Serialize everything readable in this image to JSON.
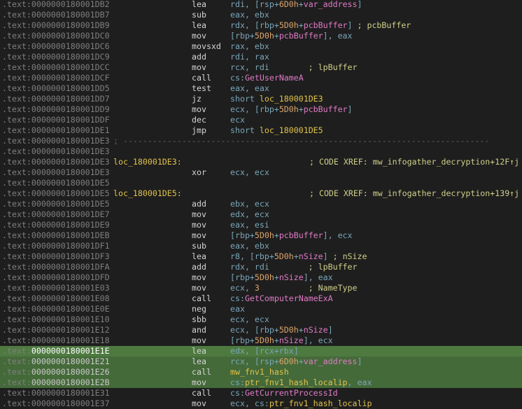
{
  "segment": ".text",
  "lines": [
    {
      "addr": "0000000180001DB2",
      "mnem": "lea",
      "ops": [
        {
          "t": "rdi, [rsp+",
          "c": "reg"
        },
        {
          "t": "6D0h",
          "c": "num"
        },
        {
          "t": "+",
          "c": "reg"
        },
        {
          "t": "var_address",
          "c": "sym"
        },
        {
          "t": "]",
          "c": "reg"
        }
      ]
    },
    {
      "addr": "0000000180001DB7",
      "mnem": "sub",
      "ops": [
        {
          "t": "eax, ebx",
          "c": "reg"
        }
      ]
    },
    {
      "addr": "0000000180001DB9",
      "mnem": "lea",
      "ops": [
        {
          "t": "rdx, [rbp+",
          "c": "reg"
        },
        {
          "t": "5D0h",
          "c": "num"
        },
        {
          "t": "+",
          "c": "reg"
        },
        {
          "t": "pcbBuffer",
          "c": "sym"
        },
        {
          "t": "]",
          "c": "reg"
        },
        {
          "t": " ; pcbBuffer",
          "c": "cmt"
        }
      ]
    },
    {
      "addr": "0000000180001DC0",
      "mnem": "mov",
      "ops": [
        {
          "t": "[rbp+",
          "c": "reg"
        },
        {
          "t": "5D0h",
          "c": "num"
        },
        {
          "t": "+",
          "c": "reg"
        },
        {
          "t": "pcbBuffer",
          "c": "sym"
        },
        {
          "t": "], eax",
          "c": "reg"
        }
      ]
    },
    {
      "addr": "0000000180001DC6",
      "mnem": "movsxd",
      "ops": [
        {
          "t": "rax, ebx",
          "c": "reg"
        }
      ]
    },
    {
      "addr": "0000000180001DC9",
      "mnem": "add",
      "ops": [
        {
          "t": "rdi, rax",
          "c": "reg"
        }
      ]
    },
    {
      "addr": "0000000180001DCC",
      "mnem": "mov",
      "ops": [
        {
          "t": "rcx, rdi",
          "c": "reg"
        },
        {
          "t": "        ; lpBuffer",
          "c": "cmt"
        }
      ]
    },
    {
      "addr": "0000000180001DCF",
      "mnem": "call",
      "ops": [
        {
          "t": "cs:",
          "c": "reg"
        },
        {
          "t": "GetUserNameA",
          "c": "api"
        }
      ]
    },
    {
      "addr": "0000000180001DD5",
      "mnem": "test",
      "ops": [
        {
          "t": "eax, eax",
          "c": "reg"
        }
      ]
    },
    {
      "addr": "0000000180001DD7",
      "mnem": "jz",
      "ops": [
        {
          "t": "short ",
          "c": "reg"
        },
        {
          "t": "loc_180001DE3",
          "c": "lbl"
        }
      ]
    },
    {
      "addr": "0000000180001DD9",
      "mnem": "mov",
      "ops": [
        {
          "t": "ecx, [rbp+",
          "c": "reg"
        },
        {
          "t": "5D0h",
          "c": "num"
        },
        {
          "t": "+",
          "c": "reg"
        },
        {
          "t": "pcbBuffer",
          "c": "sym"
        },
        {
          "t": "]",
          "c": "reg"
        }
      ]
    },
    {
      "addr": "0000000180001DDF",
      "mnem": "dec",
      "ops": [
        {
          "t": "ecx",
          "c": "reg"
        }
      ]
    },
    {
      "addr": "0000000180001DE1",
      "mnem": "jmp",
      "ops": [
        {
          "t": "short ",
          "c": "reg"
        },
        {
          "t": "loc_180001DE5",
          "c": "lbl"
        }
      ]
    },
    {
      "addr": "0000000180001DE3",
      "sep": "; ---------------------------------------------------------------------------"
    },
    {
      "addr": "0000000180001DE3"
    },
    {
      "addr": "0000000180001DE3",
      "label": "loc_180001DE3:",
      "xref": "; CODE XREF: mw_infogather_decryption+12F↑j"
    },
    {
      "addr": "0000000180001DE3",
      "mnem": "xor",
      "ops": [
        {
          "t": "ecx, ecx",
          "c": "reg"
        }
      ]
    },
    {
      "addr": "0000000180001DE5"
    },
    {
      "addr": "0000000180001DE5",
      "label": "loc_180001DE5:",
      "xref": "; CODE XREF: mw_infogather_decryption+139↑j"
    },
    {
      "addr": "0000000180001DE5",
      "mnem": "add",
      "ops": [
        {
          "t": "ebx, ecx",
          "c": "reg"
        }
      ]
    },
    {
      "addr": "0000000180001DE7",
      "mnem": "mov",
      "ops": [
        {
          "t": "edx, ecx",
          "c": "reg"
        }
      ]
    },
    {
      "addr": "0000000180001DE9",
      "mnem": "mov",
      "ops": [
        {
          "t": "eax, esi",
          "c": "reg"
        }
      ]
    },
    {
      "addr": "0000000180001DEB",
      "mnem": "mov",
      "ops": [
        {
          "t": "[rbp+",
          "c": "reg"
        },
        {
          "t": "5D0h",
          "c": "num"
        },
        {
          "t": "+",
          "c": "reg"
        },
        {
          "t": "pcbBuffer",
          "c": "sym"
        },
        {
          "t": "], ecx",
          "c": "reg"
        }
      ]
    },
    {
      "addr": "0000000180001DF1",
      "mnem": "sub",
      "ops": [
        {
          "t": "eax, ebx",
          "c": "reg"
        }
      ]
    },
    {
      "addr": "0000000180001DF3",
      "mnem": "lea",
      "ops": [
        {
          "t": "r8, [rbp+",
          "c": "reg"
        },
        {
          "t": "5D0h",
          "c": "num"
        },
        {
          "t": "+",
          "c": "reg"
        },
        {
          "t": "nSize",
          "c": "sym"
        },
        {
          "t": "]",
          "c": "reg"
        },
        {
          "t": " ; nSize",
          "c": "cmt"
        }
      ]
    },
    {
      "addr": "0000000180001DFA",
      "mnem": "add",
      "ops": [
        {
          "t": "rdx, rdi",
          "c": "reg"
        },
        {
          "t": "        ; lpBuffer",
          "c": "cmt"
        }
      ]
    },
    {
      "addr": "0000000180001DFD",
      "mnem": "mov",
      "ops": [
        {
          "t": "[rbp+",
          "c": "reg"
        },
        {
          "t": "5D0h",
          "c": "num"
        },
        {
          "t": "+",
          "c": "reg"
        },
        {
          "t": "nSize",
          "c": "sym"
        },
        {
          "t": "], eax",
          "c": "reg"
        }
      ]
    },
    {
      "addr": "0000000180001E03",
      "mnem": "mov",
      "ops": [
        {
          "t": "ecx, ",
          "c": "reg"
        },
        {
          "t": "3",
          "c": "num"
        },
        {
          "t": "          ; NameType",
          "c": "cmt"
        }
      ]
    },
    {
      "addr": "0000000180001E08",
      "mnem": "call",
      "ops": [
        {
          "t": "cs:",
          "c": "reg"
        },
        {
          "t": "GetComputerNameExA",
          "c": "api"
        }
      ]
    },
    {
      "addr": "0000000180001E0E",
      "mnem": "neg",
      "ops": [
        {
          "t": "eax",
          "c": "reg"
        }
      ]
    },
    {
      "addr": "0000000180001E10",
      "mnem": "sbb",
      "ops": [
        {
          "t": "ecx, ecx",
          "c": "reg"
        }
      ]
    },
    {
      "addr": "0000000180001E12",
      "mnem": "and",
      "ops": [
        {
          "t": "ecx, [rbp+",
          "c": "reg"
        },
        {
          "t": "5D0h",
          "c": "num"
        },
        {
          "t": "+",
          "c": "reg"
        },
        {
          "t": "nSize",
          "c": "sym"
        },
        {
          "t": "]",
          "c": "reg"
        }
      ]
    },
    {
      "addr": "0000000180001E18",
      "mnem": "mov",
      "ops": [
        {
          "t": "[rbp+",
          "c": "reg"
        },
        {
          "t": "5D0h",
          "c": "num"
        },
        {
          "t": "+",
          "c": "reg"
        },
        {
          "t": "nSize",
          "c": "sym"
        },
        {
          "t": "], ecx",
          "c": "reg"
        }
      ]
    },
    {
      "addr": "0000000180001E1E",
      "mnem": "lea",
      "hl": "primary",
      "ops": [
        {
          "t": "edx, [rcx+rbx]",
          "c": "reg"
        }
      ]
    },
    {
      "addr": "0000000180001E21",
      "mnem": "lea",
      "hl": "yes",
      "ops": [
        {
          "t": "rcx, [rsp+",
          "c": "reg"
        },
        {
          "t": "6D0h",
          "c": "num"
        },
        {
          "t": "+",
          "c": "reg"
        },
        {
          "t": "var_address",
          "c": "sym"
        },
        {
          "t": "]",
          "c": "reg"
        }
      ]
    },
    {
      "addr": "0000000180001E26",
      "mnem": "call",
      "hl": "yes",
      "ops": [
        {
          "t": "mw_fnv1_hash",
          "c": "lbl"
        }
      ]
    },
    {
      "addr": "0000000180001E2B",
      "mnem": "mov",
      "hl": "yes",
      "ops": [
        {
          "t": "cs:",
          "c": "reg"
        },
        {
          "t": "ptr_fnv1_hash_localip",
          "c": "lbl"
        },
        {
          "t": ", eax",
          "c": "reg"
        }
      ]
    },
    {
      "addr": "0000000180001E31",
      "mnem": "call",
      "ops": [
        {
          "t": "cs:",
          "c": "reg"
        },
        {
          "t": "GetCurrentProcessId",
          "c": "api"
        }
      ]
    },
    {
      "addr": "0000000180001E37",
      "mnem": "mov",
      "ops": [
        {
          "t": "ecx, cs:",
          "c": "reg"
        },
        {
          "t": "ptr_fnv1_hash_localip",
          "c": "lbl"
        }
      ]
    }
  ]
}
